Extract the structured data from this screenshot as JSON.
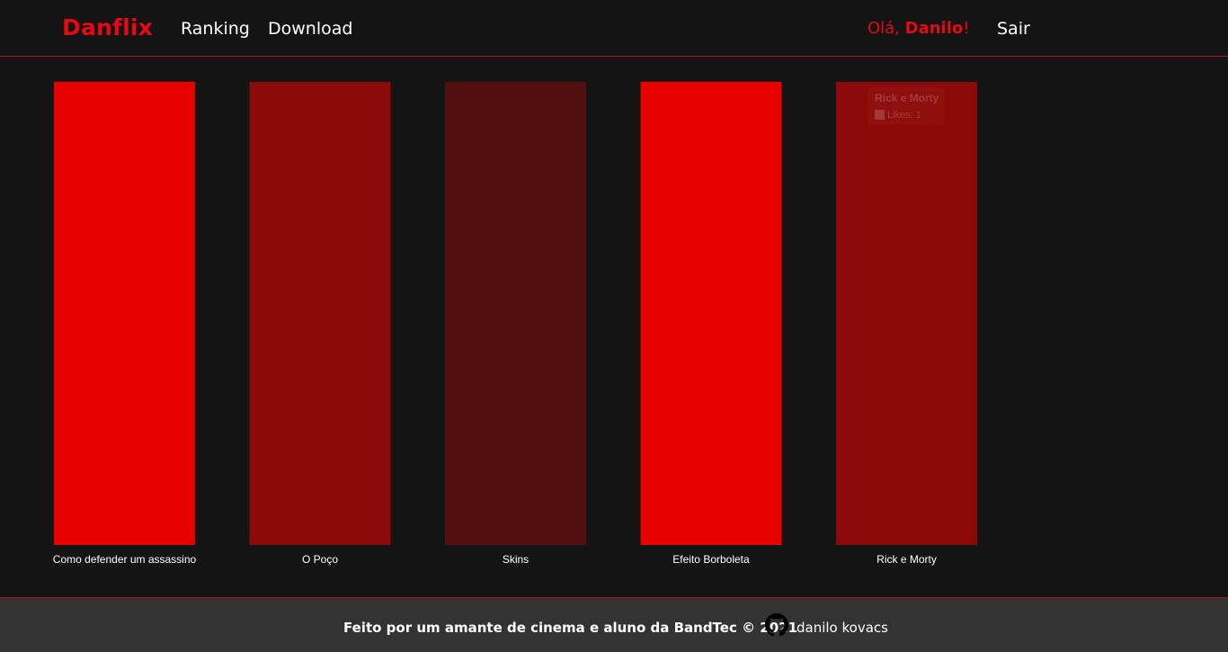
{
  "navbar": {
    "brand": "Danflix",
    "links": [
      "Ranking",
      "Download"
    ],
    "greeting_prefix": "Olá, ",
    "greeting_name": "Danilo",
    "greeting_suffix": "!",
    "logout": "Sair"
  },
  "chart_data": {
    "type": "bar",
    "categories": [
      "Como defender um assassino",
      "O Poço",
      "Skins",
      "Efeito Borboleta",
      "Rick e Morty"
    ],
    "series": [
      {
        "values": [
          1,
          1,
          1,
          1,
          1
        ],
        "colors": [
          "#e60000",
          "#8b0909",
          "#530e0e",
          "#e60000",
          "#8b0909"
        ]
      }
    ],
    "ylim": [
      0,
      1
    ],
    "grid": false,
    "title": "",
    "xlabel": "",
    "ylabel": "",
    "tooltip": {
      "category": "Rick e Morty",
      "label": "Likes: 1"
    }
  },
  "footer": {
    "text": "Feito por um amante de cinema e aluno da BandTec © 2021",
    "icon": "github-icon",
    "author": "danilo kovacs"
  }
}
